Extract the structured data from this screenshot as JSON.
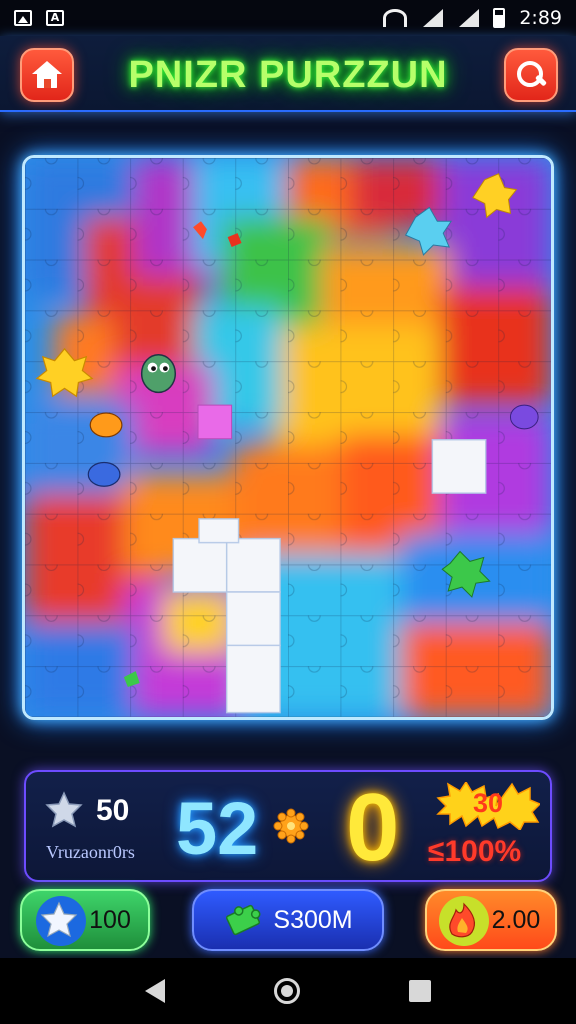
{
  "status_bar": {
    "time": "2:89",
    "icons": [
      "image-icon",
      "a-icon",
      "wifi-icon",
      "signal-icon",
      "signal-icon",
      "battery-icon"
    ]
  },
  "header": {
    "title": "PNIZR PURZZUN",
    "home_icon": "home-icon",
    "search_icon": "search-icon",
    "accent": "#39ff3a",
    "button_color": "#e2261a"
  },
  "board": {
    "grid_cols": 10,
    "grid_rows": 11,
    "missing_pieces": 9,
    "border_color": "#bfe9ff"
  },
  "stats": {
    "stars_value": "50",
    "stars_label": "Vruzaonr0rs",
    "moves": "52",
    "score": "0",
    "burst_text": "30",
    "percent": "≤100%",
    "accent_moves": "#8fe6ff",
    "accent_score": "#ffe93a",
    "accent_percent": "#ff3a2a"
  },
  "buttons": {
    "left": {
      "label": "100",
      "icon": "star-icon"
    },
    "mid": {
      "label": "S300M",
      "icon": "piece-icon"
    },
    "right": {
      "label": "2.00",
      "icon": "flame-icon"
    }
  },
  "nav": {
    "back_icon": "back-icon",
    "home_icon": "home-circle-icon",
    "recent_icon": "recent-apps-icon"
  }
}
